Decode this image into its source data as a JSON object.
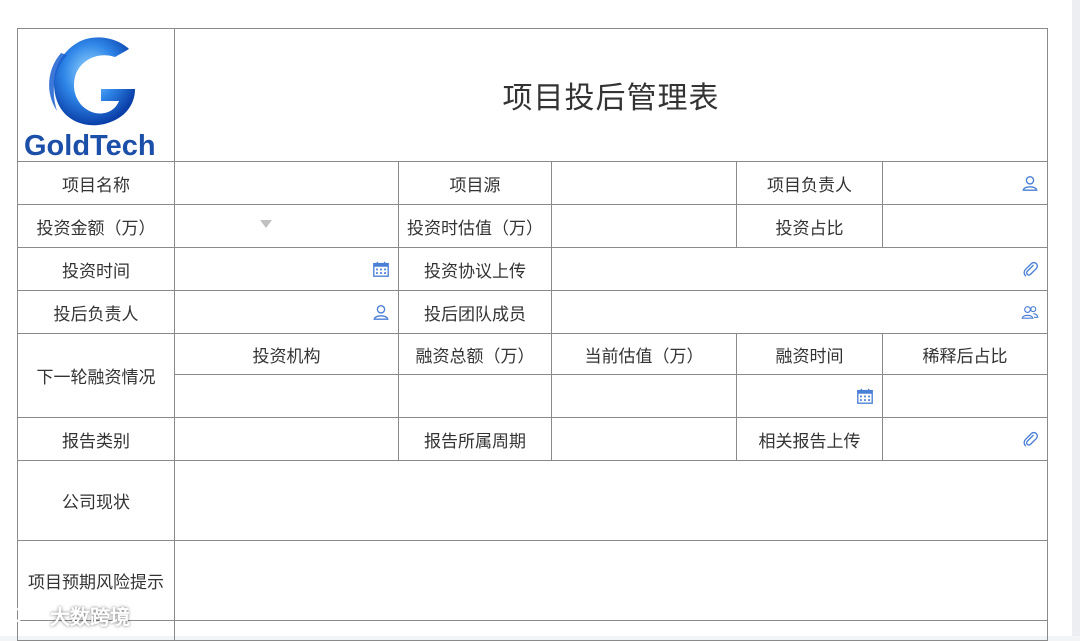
{
  "logo": {
    "text": "GoldTech",
    "letter": "G"
  },
  "title": "项目投后管理表",
  "labels": {
    "project_name": "项目名称",
    "project_source": "项目源",
    "project_lead": "项目负责人",
    "invest_amount": "投资金额（万）",
    "invest_valuation": "投资时估值（万）",
    "invest_ratio": "投资占比",
    "invest_time": "投资时间",
    "invest_agreement": "投资协议上传",
    "post_lead": "投后负责人",
    "post_team": "投后团队成员",
    "next_round": "下一轮融资情况",
    "report_type": "报告类别",
    "report_period": "报告所属周期",
    "report_upload": "相关报告上传",
    "company_status": "公司现状",
    "risk_hint": "项目预期风险提示"
  },
  "next_round_headers": [
    "投资机构",
    "融资总额（万）",
    "当前估值（万）",
    "融资时间",
    "稀释后占比"
  ],
  "icons": {
    "user": "user-icon",
    "users": "users-icon",
    "calendar": "calendar-icon",
    "attachment": "paperclip-icon",
    "dropdown": "chevron-down-icon"
  },
  "colors": {
    "icon": "#4a7fd6",
    "border": "#8a8a8a",
    "dropdown": "#c0c0c0"
  },
  "watermark": "大数跨境"
}
